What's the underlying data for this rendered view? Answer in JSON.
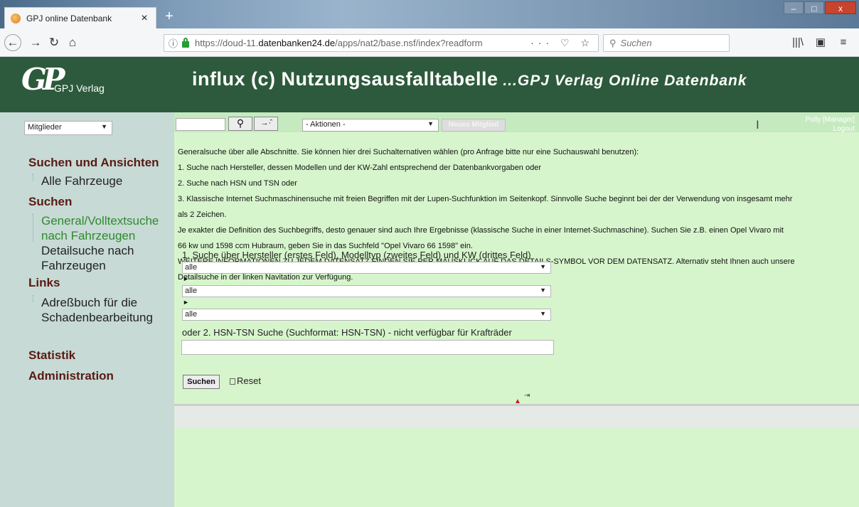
{
  "browser": {
    "tab_title": "GPJ online Datenbank",
    "tab_close": "×",
    "new_tab": "+",
    "url_prefix": "https://doud-11.",
    "url_domain": "datenbanken24.de",
    "url_path": "/apps/nat2/base.nsf/index?readform",
    "url_actions": "··· ♡ ☆",
    "search_placeholder": "Suchen",
    "win_minimize": "‒",
    "win_maximize": "□",
    "win_close": "x"
  },
  "header": {
    "logo_mark": "GP",
    "logo_text": "GPJ Verlag",
    "title": "influx (c) Nutzungsausfalltabelle",
    "subtitle": " ...GPJ Verlag Online Datenbank"
  },
  "sidebar": {
    "select_value": "Mitglieder",
    "sections": [
      {
        "title": "Suchen und Ansichten",
        "items": [
          "Alle Fahrzeuge"
        ]
      },
      {
        "title": "Suchen",
        "items": [
          "General/Volltextsuche nach Fahrzeugen",
          "Detailsuche nach Fahrzeugen"
        ]
      },
      {
        "title": "Links",
        "items": [
          "Adreßbuch für die Schadenbearbeitung"
        ]
      },
      {
        "title": "Statistik",
        "items": []
      },
      {
        "title": "Administration",
        "items": []
      }
    ]
  },
  "toolbar": {
    "search_value": "",
    "actions_select": "- Aktionen -",
    "new_member_button": "Neues Mitglied",
    "user_name": "Polly [Manager]",
    "logout": "Logout"
  },
  "main": {
    "intro_lines": [
      "Generalsuche über alle Abschnitte. Sie können hier drei Suchalternativen wählen (pro Anfrage bitte nur eine Suchauswahl benutzen):",
      "1. Suche nach Hersteller, dessen Modellen und der KW-Zahl entsprechend der Datenbankvorgaben oder",
      "2. Suche nach HSN und TSN oder",
      "3. Klassische Internet Suchmaschinensuche mit freien Begriffen mit der Lupen-Suchfunktion im Seitenkopf. Sinnvolle Suche beginnt bei der der Verwendung von insgesamt mehr",
      "als 2 Zeichen.",
      "Je exakter die Definition des Suchbegriffs, desto genauer sind auch Ihre Ergebnisse (klassische Suche in einer Internet-Suchmaschine). Suchen Sie z.B. einen Opel Vivaro mit",
      "66 kw und 1598 ccm Hubraum, geben Sie in das Suchfeld \"Opel Vivaro 66 1598\" ein.",
      "WEITERE INFORMATIONEN ZU JEDEM DATENSATZ FINDEN SIE PER MAUSKLICK AUF DAS DETAILS-SYMBOL VOR DEM DATENSATZ. Alternativ steht Ihnen auch unsere",
      "Detailsuche in der linken Navitation zur Verfügung."
    ],
    "section1_label": "1. Suche über Hersteller (erstes Feld), Modelltyp (zweites Feld) und KW (drittes Feld)",
    "select_manufacturer": "alle",
    "select_model": "alle",
    "select_kw": "alle",
    "arrow_glyph": "►",
    "section2_label": "oder 2. HSN-TSN Suche (Suchformat: HSN-TSN) - nicht verfügbar für Krafträder",
    "hsn_value": "",
    "search_button": "Suchen",
    "reset_link": "Reset"
  }
}
